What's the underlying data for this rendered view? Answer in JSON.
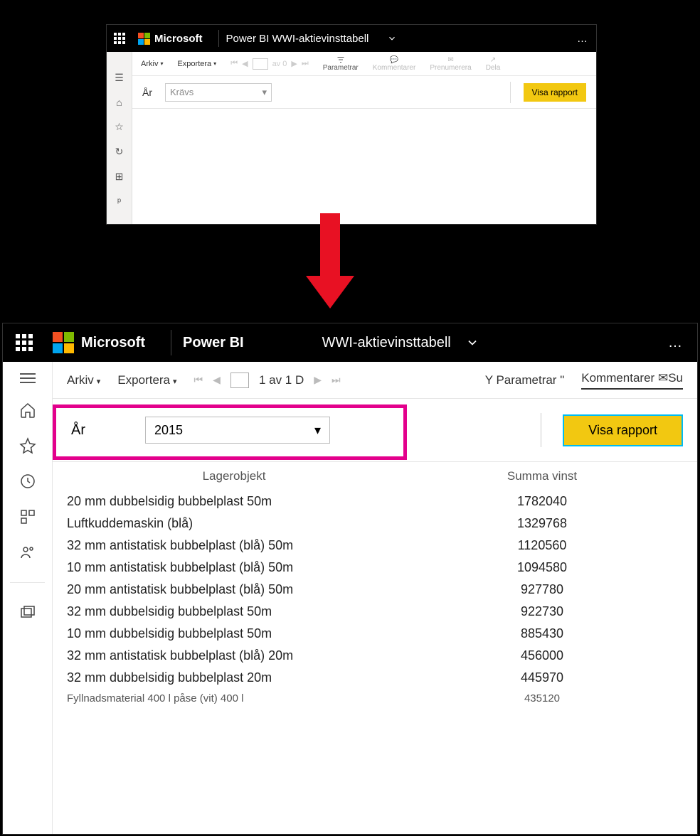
{
  "top": {
    "brand": "Microsoft",
    "app_and_title": "Power BI WWI-aktievinsttabell",
    "more": "…",
    "toolbar": {
      "arkiv": "Arkiv",
      "exportera": "Exportera",
      "page_of": "av 0",
      "parametrar": "Parametrar",
      "kommentarer": "Kommentarer",
      "prenumerera": "Prenumerera",
      "dela": "Dela"
    },
    "param": {
      "label": "År",
      "value": "Krävs",
      "button": "Visa rapport"
    }
  },
  "bottom": {
    "brand": "Microsoft",
    "app": "Power BI",
    "title": "WWI-aktievinsttabell",
    "more": "…",
    "toolbar": {
      "arkiv": "Arkiv",
      "exportera": "Exportera",
      "page_text": "1 av 1 D",
      "parametrar": "Y Parametrar \"",
      "kommentarer": "Kommentarer",
      "su": "Su"
    },
    "param": {
      "label": "År",
      "value": "2015",
      "button": "Visa rapport"
    },
    "table": {
      "col1": "Lagerobjekt",
      "col2": "Summa vinst",
      "rows": [
        {
          "item": "20 mm dubbelsidig bubbelplast 50m",
          "value": "1782040"
        },
        {
          "item": "Luftkuddemaskin (blå)",
          "value": "1329768"
        },
        {
          "item": "32 mm antistatisk bubbelplast (blå) 50m",
          "value": "1120560"
        },
        {
          "item": "10 mm antistatisk bubbelplast (blå) 50m",
          "value": "1094580"
        },
        {
          "item": "20 mm antistatisk bubbelplast (blå) 50m",
          "value": "927780"
        },
        {
          "item": "32 mm dubbelsidig bubbelplast 50m",
          "value": "922730"
        },
        {
          "item": "10 mm dubbelsidig bubbelplast 50m",
          "value": "885430"
        },
        {
          "item": "32 mm antistatisk bubbelplast (blå) 20m",
          "value": "456000"
        },
        {
          "item": "32 mm dubbelsidig bubbelplast 20m",
          "value": "445970"
        },
        {
          "item": "Fyllnadsmaterial 400 l påse (vit) 400 l",
          "value": "435120"
        }
      ]
    }
  }
}
